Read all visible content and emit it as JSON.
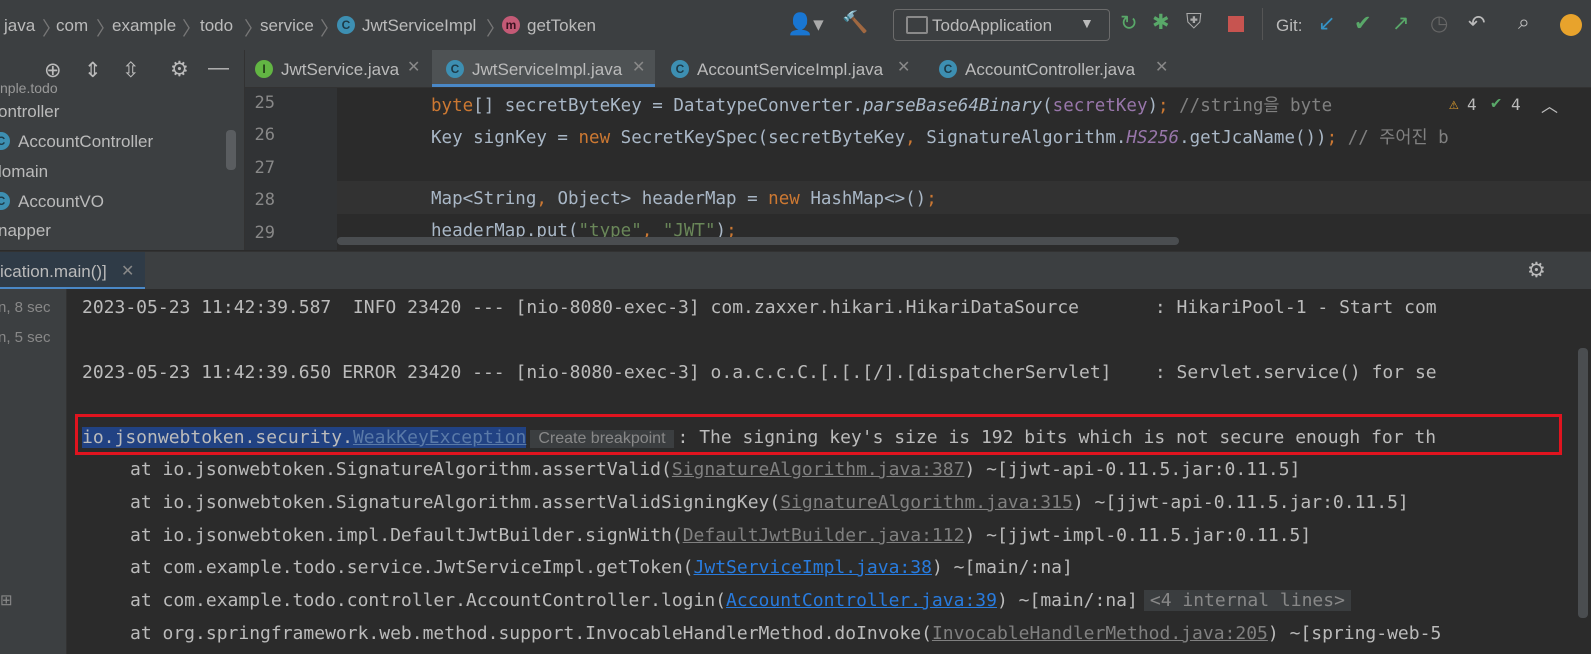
{
  "breadcrumb": {
    "items": [
      "java",
      "com",
      "example",
      "todo",
      "service",
      "JwtServiceImpl",
      "getToken"
    ]
  },
  "toolbar": {
    "run_config": "TodoApplication",
    "git_label": "Git:"
  },
  "project": {
    "items": [
      "nple.todo",
      "ontroller",
      "AccountController",
      "lomain",
      "AccountVO",
      "napper"
    ]
  },
  "editor": {
    "tabs": [
      {
        "label": "JwtService.java",
        "icon": "I"
      },
      {
        "label": "JwtServiceImpl.java",
        "icon": "C"
      },
      {
        "label": "AccountServiceImpl.java",
        "icon": "C"
      },
      {
        "label": "AccountController.java",
        "icon": "C"
      }
    ],
    "active_tab": 1,
    "line_numbers": [
      "25",
      "26",
      "27",
      "28",
      "29"
    ],
    "inspection": {
      "warnings": "4",
      "ok": "4"
    }
  },
  "run": {
    "tab_label": "ication.main()]",
    "side_items": [
      "n, 8 sec",
      "n, 5 sec"
    ]
  },
  "console": {
    "line1": "2023-05-23 11:42:39.587  INFO 23420 --- [nio-8080-exec-3] com.zaxxer.hikari.HikariDataSource       : HikariPool-1 - Start com",
    "line2": "2023-05-23 11:42:39.650 ERROR 23420 --- [nio-8080-exec-3] o.a.c.c.C.[.[.[/].[dispatcherServlet]    : Servlet.service() for se",
    "exception_pkg": "io.jsonwebtoken.security.",
    "exception_class": "WeakKeyException",
    "create_breakpoint": "Create breakpoint",
    "exception_msg": ": The signing key's size is 192 bits which is not secure enough for th",
    "trace": [
      {
        "pre": "at io.jsonwebtoken.SignatureAlgorithm.assertValid(",
        "link": "SignatureAlgorithm.java:387",
        "post": ") ~[jjwt-api-0.11.5.jar:0.11.5]"
      },
      {
        "pre": "at io.jsonwebtoken.SignatureAlgorithm.assertValidSigningKey(",
        "link": "SignatureAlgorithm.java:315",
        "post": ") ~[jjwt-api-0.11.5.jar:0.11.5]"
      },
      {
        "pre": "at io.jsonwebtoken.impl.DefaultJwtBuilder.signWith(",
        "link": "DefaultJwtBuilder.java:112",
        "post": ") ~[jjwt-impl-0.11.5.jar:0.11.5]"
      },
      {
        "pre": "at com.example.todo.service.JwtServiceImpl.getToken(",
        "link": "JwtServiceImpl.java:38",
        "post": ") ~[main/:na]"
      },
      {
        "pre": "at com.example.todo.controller.AccountController.login(",
        "link": "AccountController.java:39",
        "post": ") ~[main/:na]",
        "internal": "<4 internal lines>"
      },
      {
        "pre": "at org.springframework.web.method.support.InvocableHandlerMethod.doInvoke(",
        "link": "InvocableHandlerMethod.java:205",
        "post": ") ~[spring-web-5"
      }
    ]
  },
  "colors": {
    "accent": "#4a88c7",
    "highlight_box": "#e0141f",
    "selection": "#214283"
  }
}
